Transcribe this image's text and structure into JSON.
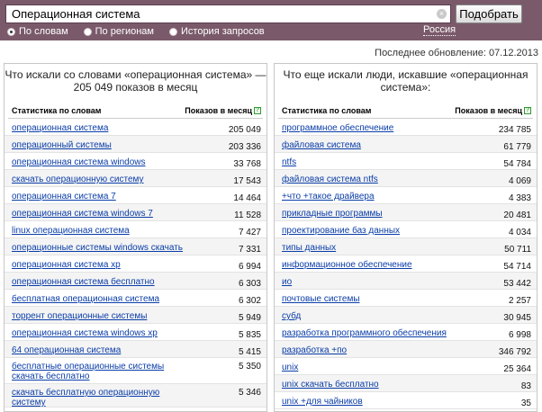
{
  "search": {
    "value": "Операционная система",
    "clear_glyph": "×",
    "button_label": "Подобрать"
  },
  "modes": [
    {
      "label": "По словам",
      "selected": true
    },
    {
      "label": "По регионам",
      "selected": false
    },
    {
      "label": "История запросов",
      "selected": false
    }
  ],
  "region": "Россия",
  "updated": "Последнее обновление: 07.12.2013",
  "left_panel": {
    "title": "Что искали со словами «операционная система» — 205 049 показов в месяц",
    "col_phrase": "Статистика по словам",
    "col_count": "Показов в месяц",
    "help_glyph": "?",
    "rows": [
      {
        "phrase": "операционная система",
        "count": "205 049"
      },
      {
        "phrase": "операционный системы",
        "count": "203 336"
      },
      {
        "phrase": "операционная система windows",
        "count": "33 768"
      },
      {
        "phrase": "скачать операционную систему",
        "count": "17 543"
      },
      {
        "phrase": "операционная система 7",
        "count": "14 464"
      },
      {
        "phrase": "операционная система windows 7",
        "count": "11 528"
      },
      {
        "phrase": "linux операционная система",
        "count": "7 427"
      },
      {
        "phrase": "операционные системы windows скачать",
        "count": "7 331"
      },
      {
        "phrase": "операционная система xp",
        "count": "6 994"
      },
      {
        "phrase": "операционная система бесплатно",
        "count": "6 303"
      },
      {
        "phrase": "бесплатная операционная система",
        "count": "6 302"
      },
      {
        "phrase": "торрент операционные системы",
        "count": "5 949"
      },
      {
        "phrase": "операционная система windows xp",
        "count": "5 835"
      },
      {
        "phrase": "64 операционная система",
        "count": "5 415"
      },
      {
        "phrase": "бесплатные операционные системы скачать бесплатно",
        "count": "5 350"
      },
      {
        "phrase": "скачать бесплатную операционную систему",
        "count": "5 346"
      }
    ]
  },
  "right_panel": {
    "title": "Что еще искали люди, искавшие «операционная система»:",
    "col_phrase": "Статистика по словам",
    "col_count": "Показов в месяц",
    "help_glyph": "?",
    "rows": [
      {
        "phrase": "программное обеспечение",
        "count": "234 785"
      },
      {
        "phrase": "файловая система",
        "count": "61 779"
      },
      {
        "phrase": "ntfs",
        "count": "54 784"
      },
      {
        "phrase": "файловая система ntfs",
        "count": "4 069"
      },
      {
        "phrase": "+что +такое драйвера",
        "count": "4 383"
      },
      {
        "phrase": "прикладные программы",
        "count": "20 481"
      },
      {
        "phrase": "проектирование баз данных",
        "count": "4 034"
      },
      {
        "phrase": "типы данных",
        "count": "50 711"
      },
      {
        "phrase": "информационное обеспечение",
        "count": "54 714"
      },
      {
        "phrase": "ио",
        "count": "53 442"
      },
      {
        "phrase": "почтовые системы",
        "count": "2 257"
      },
      {
        "phrase": "субд",
        "count": "30 945"
      },
      {
        "phrase": "разработка программного обеспечения",
        "count": "6 998"
      },
      {
        "phrase": "разработка +по",
        "count": "346 792"
      },
      {
        "phrase": "unix",
        "count": "25 364"
      },
      {
        "phrase": "unix скачать бесплатно",
        "count": "83"
      },
      {
        "phrase": "unix +для чайников",
        "count": "35"
      }
    ]
  }
}
